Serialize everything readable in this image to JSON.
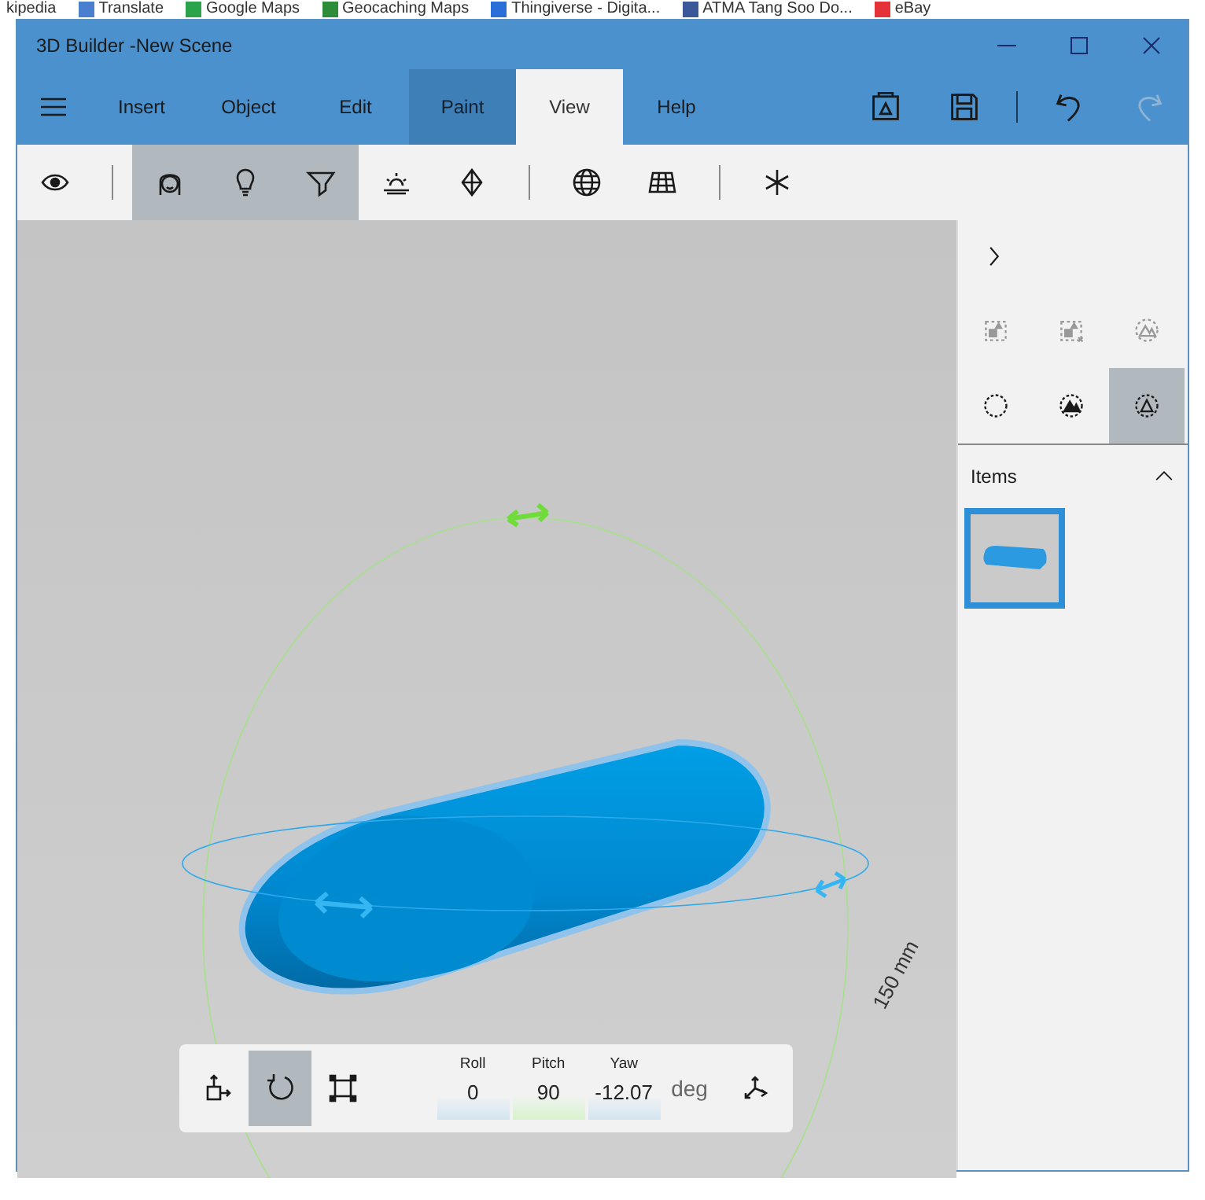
{
  "bookmarks": [
    {
      "label": "kipedia"
    },
    {
      "label": "Translate"
    },
    {
      "label": "Google Maps"
    },
    {
      "label": "Geocaching Maps"
    },
    {
      "label": "Thingiverse - Digita..."
    },
    {
      "label": "ATMA Tang Soo Do..."
    },
    {
      "label": "eBay"
    }
  ],
  "window": {
    "title": "3D Builder -New Scene"
  },
  "tabs": [
    {
      "label": "Insert",
      "selected": false,
      "hovered": false
    },
    {
      "label": "Object",
      "selected": false,
      "hovered": false
    },
    {
      "label": "Edit",
      "selected": false,
      "hovered": false
    },
    {
      "label": "Paint",
      "selected": false,
      "hovered": true
    },
    {
      "label": "View",
      "selected": true,
      "hovered": false
    },
    {
      "label": "Help",
      "selected": false,
      "hovered": false
    }
  ],
  "header_actions": [
    {
      "kind": "print",
      "disabled": false
    },
    {
      "kind": "save",
      "disabled": false
    },
    {
      "kind": "undo",
      "disabled": false
    },
    {
      "kind": "redo",
      "disabled": true
    }
  ],
  "toolbar": [
    {
      "kind": "eye",
      "selected": false
    },
    {
      "kind": "separator"
    },
    {
      "kind": "face",
      "selected": true
    },
    {
      "kind": "bulb",
      "selected": true
    },
    {
      "kind": "spotlight",
      "selected": true
    },
    {
      "kind": "sunrise",
      "selected": false
    },
    {
      "kind": "diamond",
      "selected": false
    },
    {
      "kind": "separator"
    },
    {
      "kind": "globe",
      "selected": false
    },
    {
      "kind": "grid",
      "selected": false
    },
    {
      "kind": "separator"
    },
    {
      "kind": "asterisk",
      "selected": false
    }
  ],
  "viewport": {
    "dimension_label": "150 mm"
  },
  "side_panel": {
    "modes": [
      {
        "kind": "select-box",
        "selected": false
      },
      {
        "kind": "select-box-x",
        "selected": false
      },
      {
        "kind": "circle-peaks",
        "selected": false
      },
      {
        "kind": "circle",
        "selected": false
      },
      {
        "kind": "circle-peaks-solid",
        "selected": false
      },
      {
        "kind": "circle-triangle",
        "selected": true
      }
    ],
    "items_header": "Items",
    "items_expanded": true,
    "items": [
      {
        "selected": true
      }
    ]
  },
  "transform_bar": {
    "tools": [
      {
        "kind": "move",
        "selected": false
      },
      {
        "kind": "rotate",
        "selected": true
      },
      {
        "kind": "scale",
        "selected": false
      }
    ],
    "axes": [
      {
        "label": "Roll",
        "value": "0",
        "color": "#d3e5f0"
      },
      {
        "label": "Pitch",
        "value": "90",
        "color": "#d8f2cc"
      },
      {
        "label": "Yaw",
        "value": "-12.07",
        "color": "#d3e5f0"
      }
    ],
    "unit": "deg"
  }
}
